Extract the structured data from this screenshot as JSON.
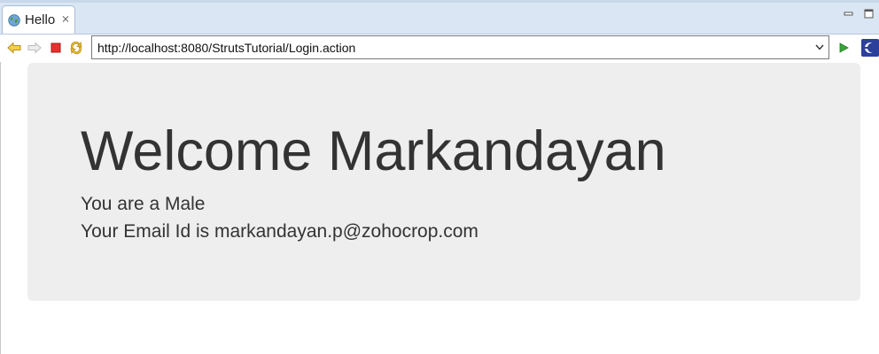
{
  "tab": {
    "title": "Hello",
    "icon": "globe-icon",
    "close_icon": "close-icon"
  },
  "window_controls": [
    "minimize-icon",
    "maximize-icon"
  ],
  "toolbar": {
    "buttons": [
      "back-arrow-icon",
      "forward-arrow-icon",
      "stop-icon",
      "refresh-icon"
    ],
    "url": "http://localhost:8080/StrutsTutorial/Login.action",
    "go_icon": "go-play-icon",
    "eclipse_icon": "eclipse-icon"
  },
  "page": {
    "heading": "Welcome Markandayan",
    "gender_line": "You are a Male",
    "email_line": "Your Email Id is markandayan.p@zohocrop.com"
  },
  "colors": {
    "tabbar_bg": "#dbe6f4",
    "jumbotron_bg": "#eeeeee",
    "text": "#333333",
    "stop_red": "#e8302c",
    "go_green": "#3aa43a"
  }
}
